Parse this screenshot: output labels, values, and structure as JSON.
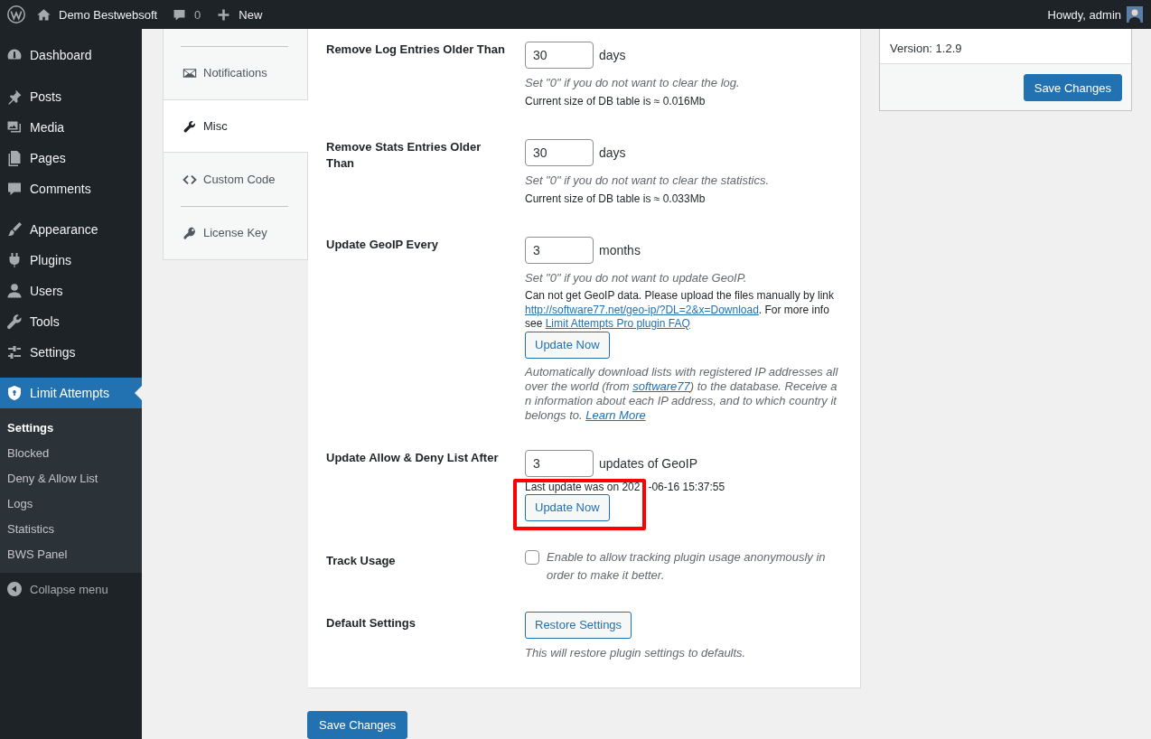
{
  "admin_bar": {
    "site_name": "Demo Bestwebsoft",
    "comments": "0",
    "new": "New",
    "greeting": "Howdy, admin"
  },
  "sidebar": {
    "groups": [
      {
        "items": [
          {
            "label": "Dashboard",
            "selected": false
          }
        ]
      },
      {
        "items": [
          {
            "label": "Posts",
            "selected": false
          },
          {
            "label": "Media",
            "selected": false
          },
          {
            "label": "Pages",
            "selected": false
          },
          {
            "label": "Comments",
            "selected": false
          }
        ]
      },
      {
        "items": [
          {
            "label": "Appearance",
            "selected": false
          },
          {
            "label": "Plugins",
            "selected": false
          },
          {
            "label": "Users",
            "selected": false
          },
          {
            "label": "Tools",
            "selected": false
          },
          {
            "label": "Settings",
            "selected": false
          }
        ]
      },
      {
        "items": [
          {
            "label": "Limit Attempts",
            "selected": true,
            "children": [
              {
                "label": "Settings",
                "selected": true
              },
              {
                "label": "Blocked",
                "selected": false
              },
              {
                "label": "Deny & Allow List",
                "selected": false
              },
              {
                "label": "Logs",
                "selected": false
              },
              {
                "label": "Statistics",
                "selected": false
              },
              {
                "label": "BWS Panel",
                "selected": false
              }
            ]
          }
        ]
      }
    ],
    "collapse": "Collapse menu"
  },
  "tabs": [
    {
      "label": "Notifications",
      "selected": false
    },
    {
      "label": "Misc",
      "selected": true
    },
    {
      "label": "Custom Code",
      "selected": false
    },
    {
      "label": "License Key",
      "selected": false
    }
  ],
  "settings": [
    {
      "label": "Remove Log Entries Older Than",
      "highlighted": false,
      "control": {
        "kind": "number",
        "value": "30",
        "unit": "days"
      },
      "blocks": [
        {
          "kind": "description",
          "text": "Set \"0\" if you do not want to clear the log."
        },
        {
          "kind": "note",
          "text": "Current size of DB table is ≈ 0.016Mb"
        }
      ]
    },
    {
      "label": "Remove Stats Entries Older Than",
      "highlighted": false,
      "control": {
        "kind": "number",
        "value": "30",
        "unit": "days"
      },
      "blocks": [
        {
          "kind": "description",
          "text": "Set \"0\" if you do not want to clear the statistics."
        },
        {
          "kind": "note",
          "text": "Current size of DB table is ≈ 0.033Mb"
        }
      ]
    },
    {
      "label": "Update GeoIP Every",
      "highlighted": false,
      "control": {
        "kind": "number",
        "value": "3",
        "unit": "months"
      },
      "blocks": [
        {
          "kind": "description",
          "text": "Set \"0\" if you do not want to update GeoIP."
        },
        {
          "kind": "notice",
          "segments": [
            {
              "kind": "text",
              "text": "Can not get GeoIP data. Please upload the files manually by link "
            },
            {
              "kind": "link",
              "text": "http://software77.net/geo-ip/?DL=2&x=Download"
            },
            {
              "kind": "text",
              "text": ". For more info see "
            },
            {
              "kind": "link",
              "text": "Limit Attempts Pro plugin FAQ"
            }
          ]
        },
        {
          "kind": "button",
          "text": "Update Now"
        },
        {
          "kind": "info",
          "segments": [
            {
              "kind": "text",
              "text": "Automatically download lists with registered IP addresses all over the world (from "
            },
            {
              "kind": "link",
              "text": "software77"
            },
            {
              "kind": "text",
              "text": ") to the database. Receive an information about each IP address, and to which country it belongs to. "
            },
            {
              "kind": "link",
              "text": "Learn More"
            }
          ]
        }
      ]
    },
    {
      "label": "Update Allow & Deny List After",
      "highlighted": true,
      "control": {
        "kind": "number",
        "value": "3",
        "unit": "updates of GeoIP"
      },
      "blocks": [
        {
          "kind": "note",
          "parts": [
            "Last update was on 202",
            "-06-16 15:37:55"
          ]
        },
        {
          "kind": "button",
          "text": "Update Now"
        }
      ]
    },
    {
      "label": "Track Usage",
      "highlighted": false,
      "control": {
        "kind": "checkbox",
        "checked": false,
        "text": "Enable to allow tracking plugin usage anonymously in order to make it better."
      }
    },
    {
      "label": "Default Settings",
      "highlighted": false,
      "control": {
        "kind": "button",
        "text": "Restore Settings"
      },
      "blocks": [
        {
          "kind": "description",
          "text": "This will restore plugin settings to defaults."
        }
      ]
    }
  ],
  "save_button": "Save Changes",
  "info_box": {
    "version": "Version: 1.2.9",
    "save_button": "Save Changes"
  }
}
